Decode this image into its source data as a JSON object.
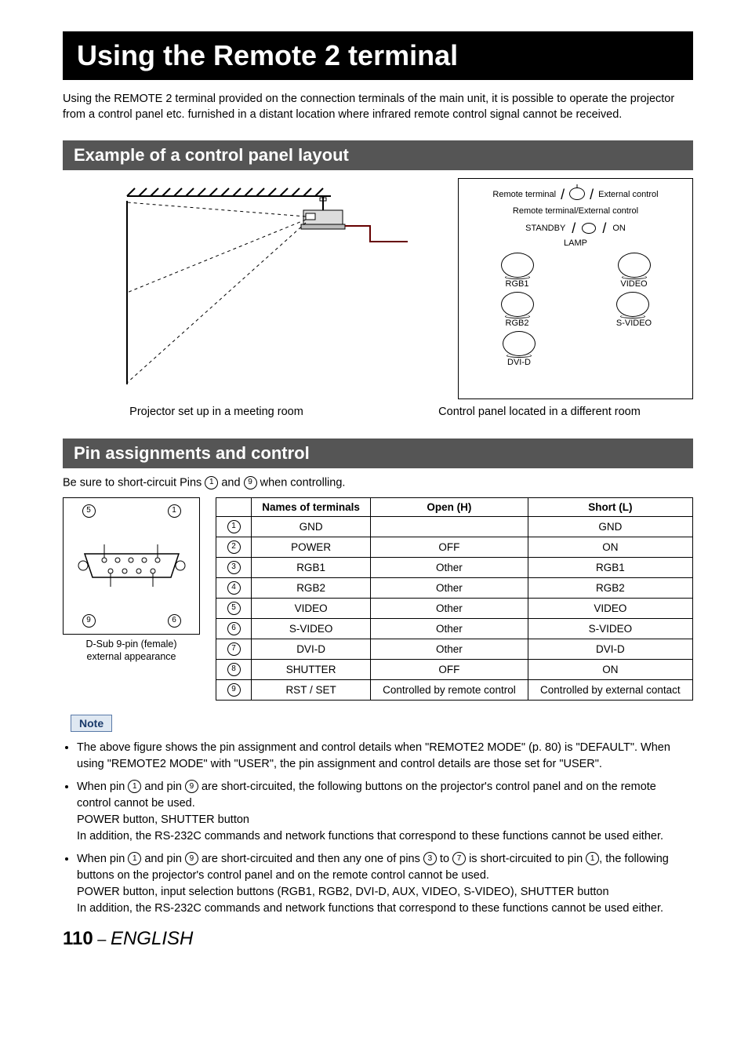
{
  "title": "Using the Remote 2 terminal",
  "intro": "Using the REMOTE 2 terminal provided on the connection terminals of the main unit, it is possible to operate the projector from a control panel etc. furnished in a distant location where infrared remote control signal cannot be received.",
  "section1": {
    "heading": "Example of a control panel layout",
    "caption_left": "Projector set up in a meeting room",
    "caption_right": "Control panel located in a different room",
    "panel": {
      "top_left": "Remote terminal",
      "top_right": "External control",
      "sub": "Remote terminal/External control",
      "standby": "STANDBY",
      "on": "ON",
      "lamp": "LAMP",
      "buttons": [
        "RGB1",
        "VIDEO",
        "RGB2",
        "S-VIDEO",
        "DVI-D"
      ]
    }
  },
  "section2": {
    "heading": "Pin assignments and control",
    "intro_pre": "Be sure to short-circuit Pins ",
    "intro_mid": " and ",
    "intro_post": " when controlling.",
    "pin_a": "1",
    "pin_b": "9",
    "connector_caption1": "D-Sub 9-pin (female)",
    "connector_caption2": "external appearance",
    "conn_labels": {
      "tl": "5",
      "tr": "1",
      "bl": "9",
      "br": "6"
    },
    "table": {
      "headers": [
        "",
        "Names of terminals",
        "Open (H)",
        "Short (L)"
      ],
      "rows": [
        {
          "n": "1",
          "name": "GND",
          "open": "",
          "short": "GND"
        },
        {
          "n": "2",
          "name": "POWER",
          "open": "OFF",
          "short": "ON"
        },
        {
          "n": "3",
          "name": "RGB1",
          "open": "Other",
          "short": "RGB1"
        },
        {
          "n": "4",
          "name": "RGB2",
          "open": "Other",
          "short": "RGB2"
        },
        {
          "n": "5",
          "name": "VIDEO",
          "open": "Other",
          "short": "VIDEO"
        },
        {
          "n": "6",
          "name": "S-VIDEO",
          "open": "Other",
          "short": "S-VIDEO"
        },
        {
          "n": "7",
          "name": "DVI-D",
          "open": "Other",
          "short": "DVI-D"
        },
        {
          "n": "8",
          "name": "SHUTTER",
          "open": "OFF",
          "short": "ON"
        },
        {
          "n": "9",
          "name": "RST / SET",
          "open": "Controlled by remote control",
          "short": "Controlled by external contact"
        }
      ]
    }
  },
  "note": {
    "label": "Note",
    "items": [
      {
        "segments": [
          {
            "t": "The above figure shows the pin assignment and control details when \"REMOTE2 MODE\" (p. 80) is \"DEFAULT\". When using \"REMOTE2 MODE\" with \"USER\", the pin assignment and control details are those set for \"USER\"."
          }
        ]
      },
      {
        "segments": [
          {
            "t": "When pin "
          },
          {
            "c": "1"
          },
          {
            "t": " and pin "
          },
          {
            "c": "9"
          },
          {
            "t": " are short-circuited, the following buttons on the projector's control panel and on the remote control cannot be used."
          },
          {
            "br": true
          },
          {
            "t": "POWER button, SHUTTER button"
          },
          {
            "br": true
          },
          {
            "t": "In addition, the RS-232C commands and network functions that correspond to these functions cannot be used either."
          }
        ]
      },
      {
        "segments": [
          {
            "t": "When pin "
          },
          {
            "c": "1"
          },
          {
            "t": " and pin "
          },
          {
            "c": "9"
          },
          {
            "t": " are short-circuited and then any one of pins "
          },
          {
            "c": "3"
          },
          {
            "t": " to "
          },
          {
            "c": "7"
          },
          {
            "t": " is short-circuited to pin "
          },
          {
            "c": "1"
          },
          {
            "t": ", the following buttons on the projector's control panel and on the remote control cannot be used."
          },
          {
            "br": true
          },
          {
            "t": "POWER button, input selection buttons (RGB1, RGB2, DVI-D, AUX, VIDEO, S-VIDEO), SHUTTER button"
          },
          {
            "br": true
          },
          {
            "t": "In addition, the RS-232C commands and network functions that correspond to these functions cannot be used either."
          }
        ]
      }
    ]
  },
  "footer": {
    "page": "110",
    "sep": " – ",
    "lang": "ENGLISH"
  }
}
